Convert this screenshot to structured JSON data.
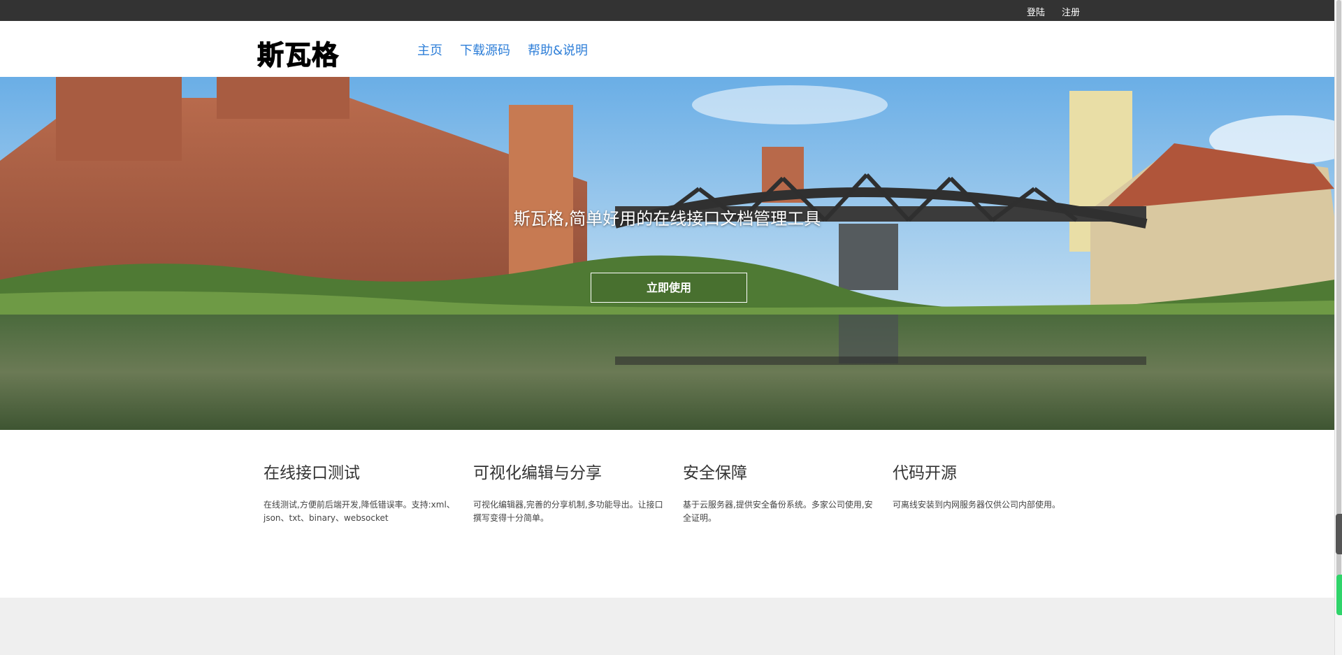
{
  "topbar": {
    "login_label": "登陆",
    "register_label": "注册"
  },
  "header": {
    "logo": "斯瓦格",
    "nav": [
      {
        "label": "主页"
      },
      {
        "label": "下载源码"
      },
      {
        "label": "帮助&说明"
      }
    ]
  },
  "hero": {
    "title": "斯瓦格,简单好用的在线接口文档管理工具",
    "button_label": "立即使用"
  },
  "features": [
    {
      "title": "在线接口测试",
      "desc": "在线测试,方便前后端开发,降低错误率。支持:xml、json、txt、binary、websocket"
    },
    {
      "title": "可视化编辑与分享",
      "desc": "可视化编辑器,完善的分享机制,多功能导出。让接口撰写变得十分简单。"
    },
    {
      "title": "安全保障",
      "desc": "基于云服务器,提供安全备份系统。多家公司使用,安全证明。"
    },
    {
      "title": "代码开源",
      "desc": "可离线安装到内网服务器仅供公司内部使用。"
    }
  ],
  "colors": {
    "topbar": "#333333",
    "nav_link": "#2f7fd8",
    "accent_green": "#2fd46a"
  }
}
